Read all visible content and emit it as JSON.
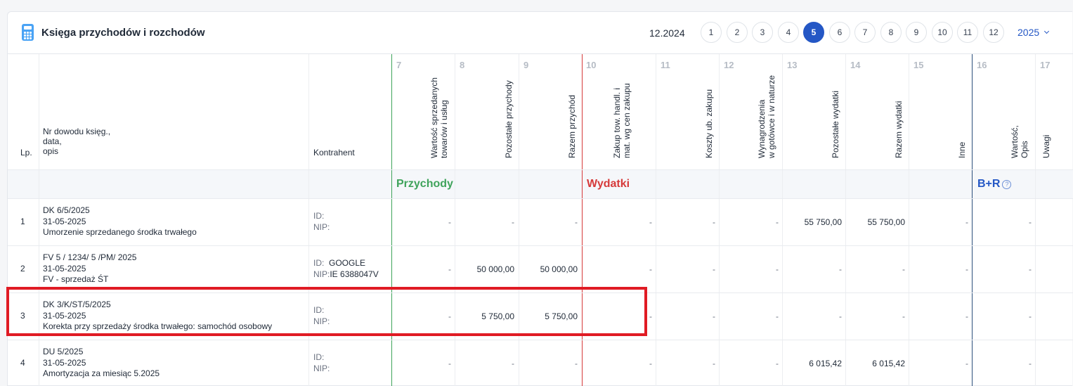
{
  "header": {
    "title": "Księga przychodów i rozchodów",
    "period": "12.2024",
    "months": [
      "1",
      "2",
      "3",
      "4",
      "5",
      "6",
      "7",
      "8",
      "9",
      "10",
      "11",
      "12"
    ],
    "active_month": "5",
    "year": "2025"
  },
  "columns": {
    "lp": "Lp.",
    "doc": [
      "Nr dowodu księg.,",
      "data,",
      "opis"
    ],
    "contractor": "Kontrahent",
    "numbered": [
      {
        "num": "7",
        "label": [
          "Wartość sprzedanych",
          "towarów i usług"
        ]
      },
      {
        "num": "8",
        "label": [
          "Pozostałe przychody"
        ]
      },
      {
        "num": "9",
        "label": [
          "Razem przychód"
        ]
      },
      {
        "num": "10",
        "label": [
          "Zakup tow. handl. i",
          "mat. wg cen zakupu"
        ]
      },
      {
        "num": "11",
        "label": [
          "Koszty ub. zakupu"
        ]
      },
      {
        "num": "12",
        "label": [
          "Wynagrodzenia",
          "w gotówce i w naturze"
        ]
      },
      {
        "num": "13",
        "label": [
          "Pozostałe wydatki"
        ]
      },
      {
        "num": "14",
        "label": [
          "Razem wydatki"
        ]
      },
      {
        "num": "15",
        "label": [
          "Inne"
        ]
      },
      {
        "num": "16",
        "label": [
          "Wartość,",
          "Opis"
        ]
      },
      {
        "num": "17",
        "label": [
          "Uwagi"
        ]
      }
    ]
  },
  "groups": {
    "income": "Przychody",
    "expenses": "Wydatki",
    "br": "B+R",
    "help_glyph": "?"
  },
  "colors": {
    "income": "#3fa35b",
    "expenses": "#d63a3a",
    "br": "#2457c5",
    "accent": "#2457c5",
    "highlight": "#e01b24"
  },
  "id_label": "ID:",
  "nip_label": "NIP:",
  "rows": [
    {
      "lp": "1",
      "doc_no": "DK 6/5/2025",
      "date": "31-05-2025",
      "desc": "Umorzenie sprzedanego środka trwałego",
      "id": "",
      "nip": "",
      "values": [
        "-",
        "-",
        "-",
        "-",
        "-",
        "-",
        "55 750,00",
        "55 750,00",
        "-",
        "-"
      ]
    },
    {
      "lp": "2",
      "doc_no": "FV 5 / 1234/ 5 /PM/ 2025",
      "date": "31-05-2025",
      "desc": "FV - sprzedaż ŚT",
      "id": "GOOGLE",
      "nip": "IE 6388047V",
      "values": [
        "-",
        "50 000,00",
        "50 000,00",
        "-",
        "-",
        "-",
        "-",
        "-",
        "-",
        "-"
      ]
    },
    {
      "lp": "3",
      "doc_no": "DK 3/K/ST/5/2025",
      "date": "31-05-2025",
      "desc": "Korekta przy sprzedaży środka trwałego: samochód osobowy",
      "id": "",
      "nip": "",
      "values": [
        "-",
        "5 750,00",
        "5 750,00",
        "-",
        "-",
        "-",
        "-",
        "-",
        "-",
        "-"
      ]
    },
    {
      "lp": "4",
      "doc_no": "DU 5/2025",
      "date": "31-05-2025",
      "desc": "Amortyzacja za miesiąc 5.2025",
      "id": "",
      "nip": "",
      "values": [
        "-",
        "-",
        "-",
        "-",
        "-",
        "-",
        "6 015,42",
        "6 015,42",
        "-",
        "-"
      ]
    }
  ]
}
